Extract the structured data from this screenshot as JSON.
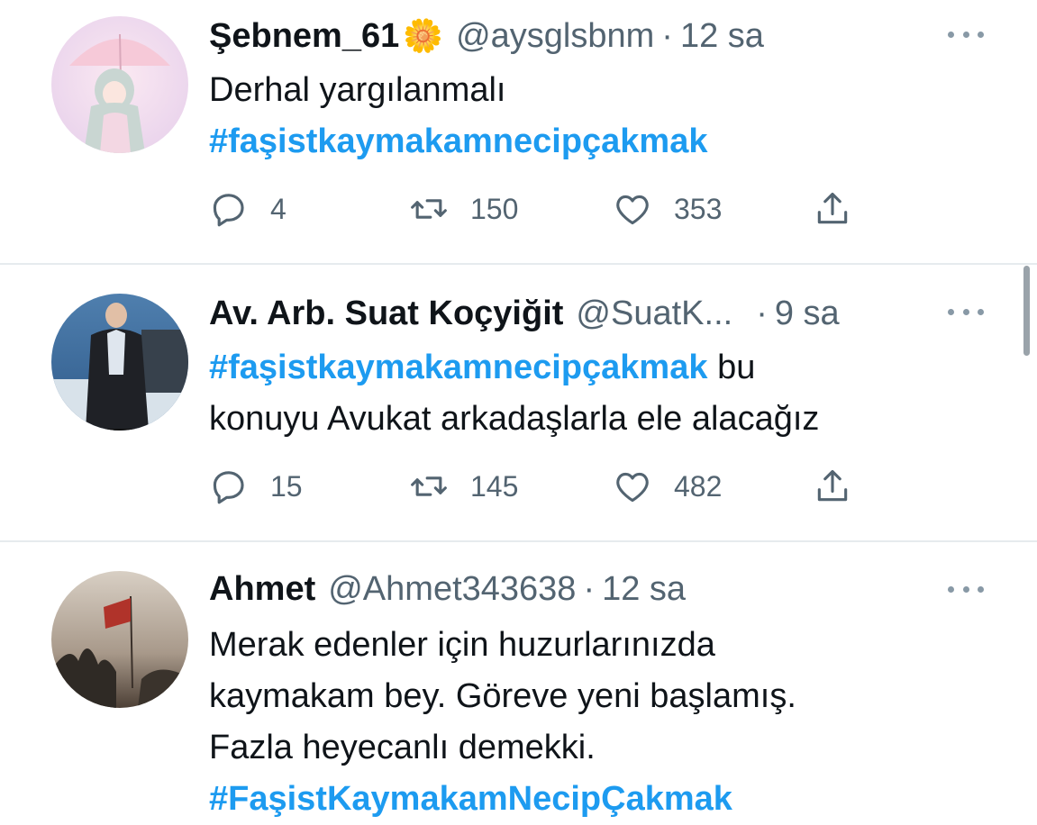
{
  "tweets": [
    {
      "name": "Şebnem_61",
      "name_emoji": "🌼",
      "handle": "@aysglsbnm",
      "time": "12 sa",
      "text": [
        "Derhal yargılanmalı"
      ],
      "hashtag": "#faşistkaymakamnecipçakmak",
      "replies": "4",
      "retweets": "150",
      "likes": "353"
    },
    {
      "name": "Av. Arb. Suat Koçyiğit",
      "handle": "@SuatK...",
      "time": "9 sa",
      "hashtag": "#faşistkaymakamnecipçakmak",
      "text_after_hashtag": "bu",
      "text": [
        "konuyu Avukat arkadaşlarla ele alacağız"
      ],
      "replies": "15",
      "retweets": "145",
      "likes": "482"
    },
    {
      "name": "Ahmet",
      "handle": "@Ahmet343638",
      "time": "12 sa",
      "text": [
        "Merak edenler için huzurlarınızda",
        "kaymakam bey. Göreve yeni başlamış.",
        "Fazla heyecanlı demekki."
      ],
      "hashtag": "#FaşistKaymakamNecipÇakmak"
    }
  ],
  "colors": {
    "hashtag": "#1d9bf0",
    "secondary_text": "#536471",
    "primary_text": "#0f1419",
    "divider": "#e6ebee"
  },
  "icons": [
    "reply-icon",
    "retweet-icon",
    "like-icon",
    "share-icon",
    "more-icon"
  ]
}
